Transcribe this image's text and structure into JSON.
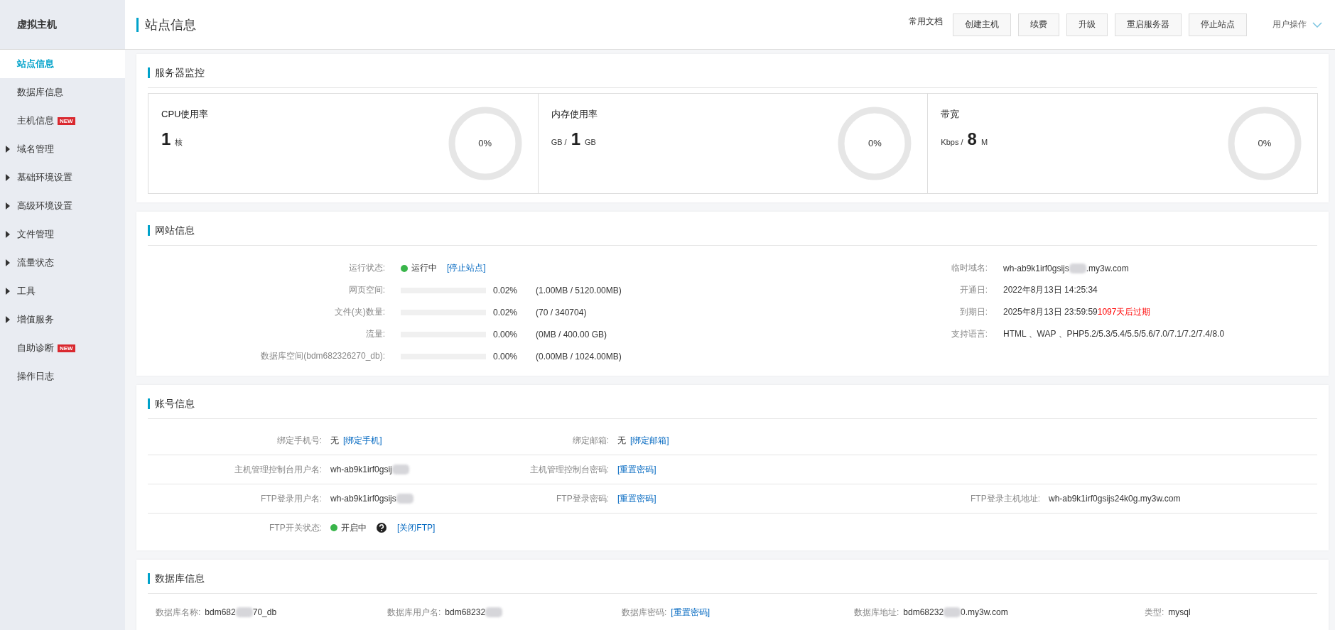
{
  "sidebar": {
    "title": "虚拟主机",
    "items": [
      {
        "label": "站点信息",
        "selected": true
      },
      {
        "label": "数据库信息",
        "selected": false
      },
      {
        "label": "主机信息",
        "selected": false,
        "badge": "NEW"
      },
      {
        "label": "域名管理",
        "selected": false,
        "expanded": false
      },
      {
        "label": "基础环境设置",
        "selected": false,
        "expanded": false
      },
      {
        "label": "高级环境设置",
        "selected": false,
        "expanded": false
      },
      {
        "label": "文件管理",
        "selected": false,
        "expanded": false
      },
      {
        "label": "流量状态",
        "selected": false,
        "expanded": false
      },
      {
        "label": "工具",
        "selected": false,
        "expanded": false
      },
      {
        "label": "增值服务",
        "selected": false,
        "expanded": false
      },
      {
        "label": "自助诊断",
        "selected": false,
        "badge": "NEW"
      },
      {
        "label": "操作日志",
        "selected": false
      }
    ]
  },
  "header": {
    "title": "站点信息",
    "docs_link": "常用文档",
    "buttons": [
      "创建主机",
      "续费",
      "升级",
      "重启服务器",
      "停止站点"
    ],
    "user_menu": "用户操作"
  },
  "server_monitor": {
    "title": "服务器监控",
    "gauges": [
      {
        "label": "CPU使用率",
        "parts": [
          {
            "kind": "big",
            "text": "1"
          },
          {
            "kind": "unit",
            "text": "核"
          }
        ],
        "reading": "0%"
      },
      {
        "label": "内存使用率",
        "parts": [
          {
            "kind": "unit",
            "text": "GB /"
          },
          {
            "kind": "big",
            "text": "1"
          },
          {
            "kind": "unit",
            "text": "GB"
          }
        ],
        "reading": "0%"
      },
      {
        "label": "带宽",
        "parts": [
          {
            "kind": "unit",
            "text": "Kbps /"
          },
          {
            "kind": "big",
            "text": "8"
          },
          {
            "kind": "unit",
            "text": "M"
          }
        ],
        "reading": "0%"
      }
    ]
  },
  "site_info": {
    "title": "网站信息",
    "left": [
      {
        "kind": "status",
        "label": "运行状态:",
        "status": "运行中",
        "color": "#39b54a",
        "link": "[停止站点]"
      },
      {
        "kind": "usage",
        "label": "网页空间:",
        "level": 0.0002,
        "percent": "0.02%",
        "detail": "(1.00MB / 5120.00MB)"
      },
      {
        "kind": "usage",
        "label": "文件(夹)数量:",
        "level": 0.0002,
        "percent": "0.02%",
        "detail": "(70 / 340704)"
      },
      {
        "kind": "usage",
        "label": "流量:",
        "level": 0,
        "percent": "0.00%",
        "detail": "(0MB / 400.00 GB)"
      },
      {
        "kind": "usage",
        "label": "数据库空间(bdm682326270_db):",
        "level": 0,
        "percent": "0.00%",
        "detail": "(0.00MB / 1024.00MB)"
      }
    ],
    "right": [
      {
        "label": "临时域名:",
        "value": [
          {
            "kind": "text",
            "text": "wh-ab9k1irf0gsijs"
          },
          {
            "kind": "blur"
          },
          {
            "kind": "text",
            "text": ".my3w.com"
          }
        ]
      },
      {
        "label": "开通日:",
        "value": [
          {
            "kind": "text",
            "text": "2022年8月13日 14:25:34"
          }
        ]
      },
      {
        "label": "到期日:",
        "value": [
          {
            "kind": "text",
            "text": "2025年8月13日 23:59:59"
          },
          {
            "kind": "warn",
            "text": "1097天后过期"
          }
        ]
      },
      {
        "label": "支持语言:",
        "value": [
          {
            "kind": "text",
            "text": "HTML 、WAP 、PHP5.2/5.3/5.4/5.5/5.6/7.0/7.1/7.2/7.4/8.0"
          }
        ]
      }
    ]
  },
  "account_info": {
    "title": "账号信息",
    "rows": [
      [
        {
          "label": "绑定手机号:",
          "value": [
            {
              "kind": "text",
              "text": "无"
            },
            {
              "kind": "link",
              "text": "[绑定手机]"
            }
          ]
        },
        {
          "label": "绑定邮箱:",
          "value": [
            {
              "kind": "text",
              "text": "无"
            },
            {
              "kind": "link",
              "text": "[绑定邮箱]"
            }
          ]
        }
      ],
      [
        {
          "label": "主机管理控制台用户名:",
          "value": [
            {
              "kind": "text",
              "text": "wh-ab9k1irf0gsij"
            },
            {
              "kind": "blur"
            }
          ]
        },
        {
          "label": "主机管理控制台密码:",
          "value": [
            {
              "kind": "link",
              "text": "[重置密码]"
            }
          ]
        }
      ],
      [
        {
          "label": "FTP登录用户名:",
          "value": [
            {
              "kind": "text",
              "text": "wh-ab9k1irf0gsijs"
            },
            {
              "kind": "blur"
            }
          ]
        },
        {
          "label": "FTP登录密码:",
          "value": [
            {
              "kind": "link",
              "text": "[重置密码]"
            }
          ]
        },
        {
          "label": "FTP登录主机地址:",
          "value": [
            {
              "kind": "text",
              "text": "wh-ab9k1irf0gsijs24k0g.my3w.com"
            }
          ]
        }
      ],
      [
        {
          "label": "FTP开关状态:",
          "value": [
            {
              "kind": "dot",
              "color": "#39b54a"
            },
            {
              "kind": "text",
              "text": "开启中"
            },
            {
              "kind": "help"
            },
            {
              "kind": "link",
              "text": "[关闭FTP]"
            }
          ]
        }
      ]
    ]
  },
  "database_info": {
    "title": "数据库信息",
    "fields": [
      {
        "label": "数据库名称:",
        "value": [
          {
            "kind": "text",
            "text": "bdm682"
          },
          {
            "kind": "blur"
          },
          {
            "kind": "text",
            "text": "70_db"
          }
        ]
      },
      {
        "label": "数据库用户名:",
        "value": [
          {
            "kind": "text",
            "text": "bdm68232"
          },
          {
            "kind": "blur"
          }
        ]
      },
      {
        "label": "数据库密码:",
        "value": [
          {
            "kind": "link",
            "text": "[重置密码]"
          }
        ]
      },
      {
        "label": "数据库地址:",
        "value": [
          {
            "kind": "text",
            "text": "bdm68232"
          },
          {
            "kind": "blur"
          },
          {
            "kind": "text",
            "text": "0.my3w.com"
          }
        ]
      },
      {
        "label": "类型:",
        "value": [
          {
            "kind": "text",
            "text": "mysql"
          }
        ]
      }
    ]
  }
}
